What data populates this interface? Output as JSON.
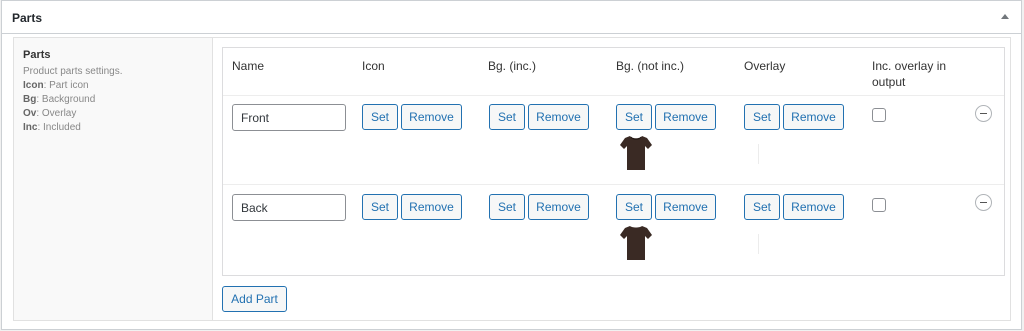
{
  "metabox": {
    "title": "Parts"
  },
  "field": {
    "label": "Parts",
    "desc": [
      {
        "text": "Product parts settings."
      },
      {
        "key": "Icon",
        "text": ": Part icon"
      },
      {
        "key": "Bg",
        "text": ": Background"
      },
      {
        "key": "Ov",
        "text": ": Overlay"
      },
      {
        "key": "Inc",
        "text": ": Included"
      }
    ]
  },
  "columns": {
    "name": "Name",
    "icon": "Icon",
    "bg_inc": "Bg. (inc.)",
    "bg_not_inc_": "Bg. (not inc.)",
    "overlay": "Overlay",
    "inc_overlay_1": "Inc. overlay in",
    "inc_overlay_2": "output"
  },
  "buttons": {
    "set": "Set",
    "remove": "Remove",
    "add_part": "Add Part"
  },
  "rows": [
    {
      "name": "Front",
      "bg_not_inc_image": "tshirt-icon",
      "inc_overlay_checked": false
    },
    {
      "name": "Back",
      "bg_not_inc_image": "tshirt-icon",
      "inc_overlay_checked": false
    }
  ],
  "colors": {
    "accent": "#2271b1",
    "tshirt": "#3a2a24",
    "border": "#ccd0d4"
  }
}
